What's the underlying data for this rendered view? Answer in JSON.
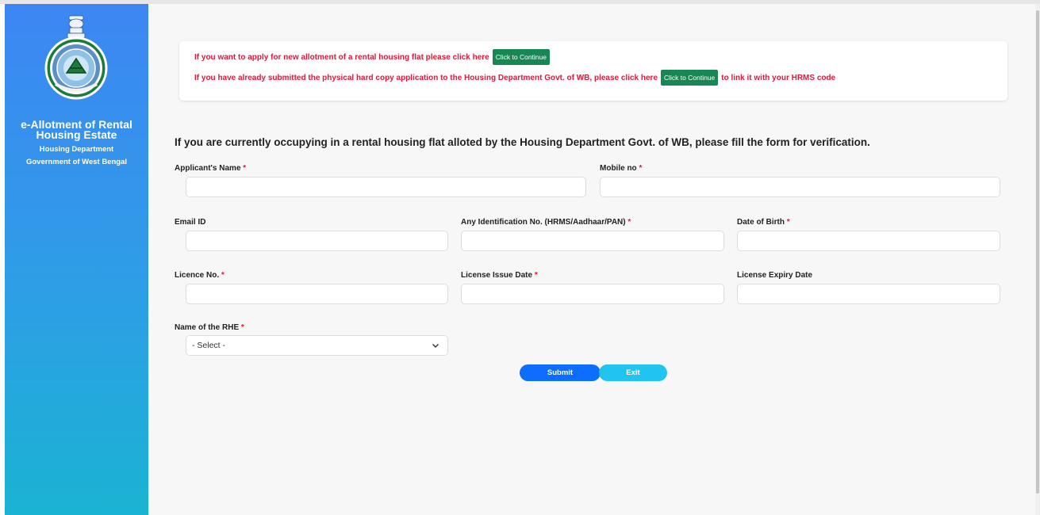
{
  "sidebar": {
    "title_line1": "e-Allotment of Rental",
    "title_line2": "Housing Estate",
    "department": "Housing Department",
    "government": "Government of West Bengal"
  },
  "notice": {
    "line1_text": "If you want to apply for new allotment of a rental housing flat please click here",
    "line1_button": "Click to Continue",
    "line2_text": "If you have already submitted the physical hard copy application to the Housing Department Govt. of WB, please click here",
    "line2_button": "Click to Continue",
    "line2_suffix": "to link it with your HRMS code"
  },
  "form": {
    "heading": "If you are currently occupying in a rental housing flat alloted by the Housing Department Govt. of WB, please fill the form for verification.",
    "required_mark": "*",
    "fields": {
      "applicant_name": {
        "label": "Applicant's Name",
        "value": ""
      },
      "mobile_no": {
        "label": "Mobile no",
        "value": ""
      },
      "email_id": {
        "label": "Email ID",
        "value": ""
      },
      "identification_no": {
        "label": "Any Identification No. (HRMS/Aadhaar/PAN)",
        "value": ""
      },
      "date_of_birth": {
        "label": "Date of Birth",
        "value": ""
      },
      "licence_no": {
        "label": "Licence No.",
        "value": ""
      },
      "license_issue_date": {
        "label": "License Issue Date",
        "value": ""
      },
      "license_expiry_date": {
        "label": "License Expiry Date",
        "value": ""
      },
      "rhe_name": {
        "label": "Name of the RHE",
        "selected": "- Select -"
      }
    },
    "submit_label": "Submit",
    "exit_label": "Exit"
  },
  "colors": {
    "sidebar_top": "#3d86f4",
    "sidebar_bottom": "#1ab3d3",
    "notice_text": "#e0193a",
    "continue_button": "#198754",
    "submit_button": "#0d6efd",
    "exit_button": "#1fc5ee"
  }
}
